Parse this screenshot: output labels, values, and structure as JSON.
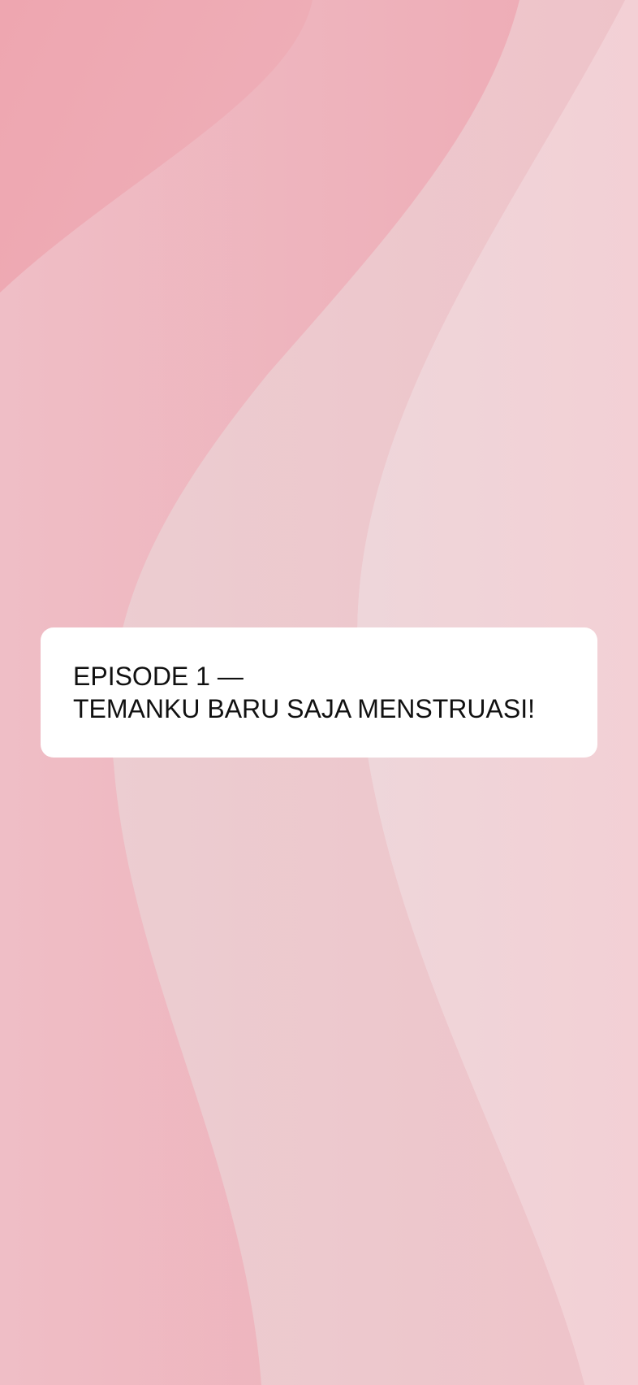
{
  "background": {
    "illustration": "pink-wave-background",
    "colors": {
      "deep_pink": "#eda3ad",
      "mid_pink": "#efb8c0",
      "light_pink": "#eecbd0",
      "pale_pink": "#f1d8dc"
    }
  },
  "card": {
    "line1": "EPISODE 1 —",
    "line2": "TEMANKU BARU SAJA MENSTRUASI!"
  }
}
